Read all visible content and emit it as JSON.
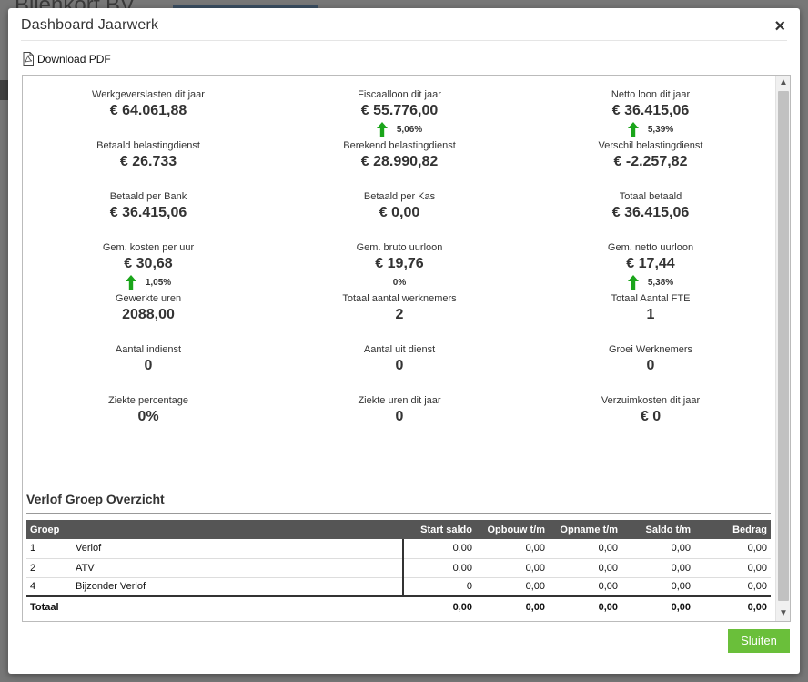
{
  "background": {
    "title": "Bijenkorf BV"
  },
  "modal": {
    "title": "Dashboard Jaarwerk",
    "close_icon": "×",
    "download_label": "Download PDF",
    "close_button": "Sluiten"
  },
  "stats": [
    [
      {
        "label": "Werkgeverslasten dit jaar",
        "value": "€ 64.061,88",
        "change": null
      },
      {
        "label": "Fiscaalloon dit jaar",
        "value": "€ 55.776,00",
        "change": "5,06%",
        "arrow": true
      },
      {
        "label": "Netto loon dit jaar",
        "value": "€ 36.415,06",
        "change": "5,39%",
        "arrow": true
      }
    ],
    [
      {
        "label": "Betaald belastingdienst",
        "value": "€ 26.733",
        "change": null
      },
      {
        "label": "Berekend belastingdienst",
        "value": "€ 28.990,82",
        "change": null
      },
      {
        "label": "Verschil belastingdienst",
        "value": "€ -2.257,82",
        "change": null
      }
    ],
    [
      {
        "label": "Betaald per Bank",
        "value": "€ 36.415,06",
        "change": null
      },
      {
        "label": "Betaald per Kas",
        "value": "€ 0,00",
        "change": null
      },
      {
        "label": "Totaal betaald",
        "value": "€ 36.415,06",
        "change": null
      }
    ],
    [
      {
        "label": "Gem. kosten per uur",
        "value": "€ 30,68",
        "change": "1,05%",
        "arrow": true
      },
      {
        "label": "Gem. bruto uurloon",
        "value": "€ 19,76",
        "change": "0%",
        "arrow": false
      },
      {
        "label": "Gem. netto uurloon",
        "value": "€ 17,44",
        "change": "5,38%",
        "arrow": true
      }
    ],
    [
      {
        "label": "Gewerkte uren",
        "value": "2088,00",
        "change": null
      },
      {
        "label": "Totaal aantal werknemers",
        "value": "2",
        "change": null
      },
      {
        "label": "Totaal Aantal FTE",
        "value": "1",
        "change": null
      }
    ],
    [
      {
        "label": "Aantal indienst",
        "value": "0",
        "change": null
      },
      {
        "label": "Aantal uit dienst",
        "value": "0",
        "change": null
      },
      {
        "label": "Groei Werknemers",
        "value": "0",
        "change": null
      }
    ],
    [
      {
        "label": "Ziekte percentage",
        "value": "0%",
        "change": null
      },
      {
        "label": "Ziekte uren dit jaar",
        "value": "0",
        "change": null
      },
      {
        "label": "Verzuimkosten dit jaar",
        "value": "€ 0",
        "change": null
      }
    ]
  ],
  "verlof": {
    "title": "Verlof Groep Overzicht",
    "columns": [
      "Groep",
      "",
      "Start saldo",
      "Opbouw t/m",
      "Opname t/m",
      "Saldo t/m",
      "Bedrag"
    ],
    "rows": [
      [
        "1",
        "Verlof",
        "0,00",
        "0,00",
        "0,00",
        "0,00",
        "0,00"
      ],
      [
        "2",
        "ATV",
        "0,00",
        "0,00",
        "0,00",
        "0,00",
        "0,00"
      ],
      [
        "4",
        "Bijzonder Verlof",
        "0",
        "0,00",
        "0,00",
        "0,00",
        "0,00"
      ]
    ],
    "total": [
      "Totaal",
      "",
      "0,00",
      "0,00",
      "0,00",
      "0,00",
      "0,00"
    ]
  },
  "colors": {
    "accent_green": "#6abf3a",
    "arrow_green": "#1aa51a",
    "table_header": "#555555"
  },
  "icons": {
    "pdf": "pdf-file-icon",
    "up": "arrow-up-icon",
    "close": "close-icon"
  }
}
